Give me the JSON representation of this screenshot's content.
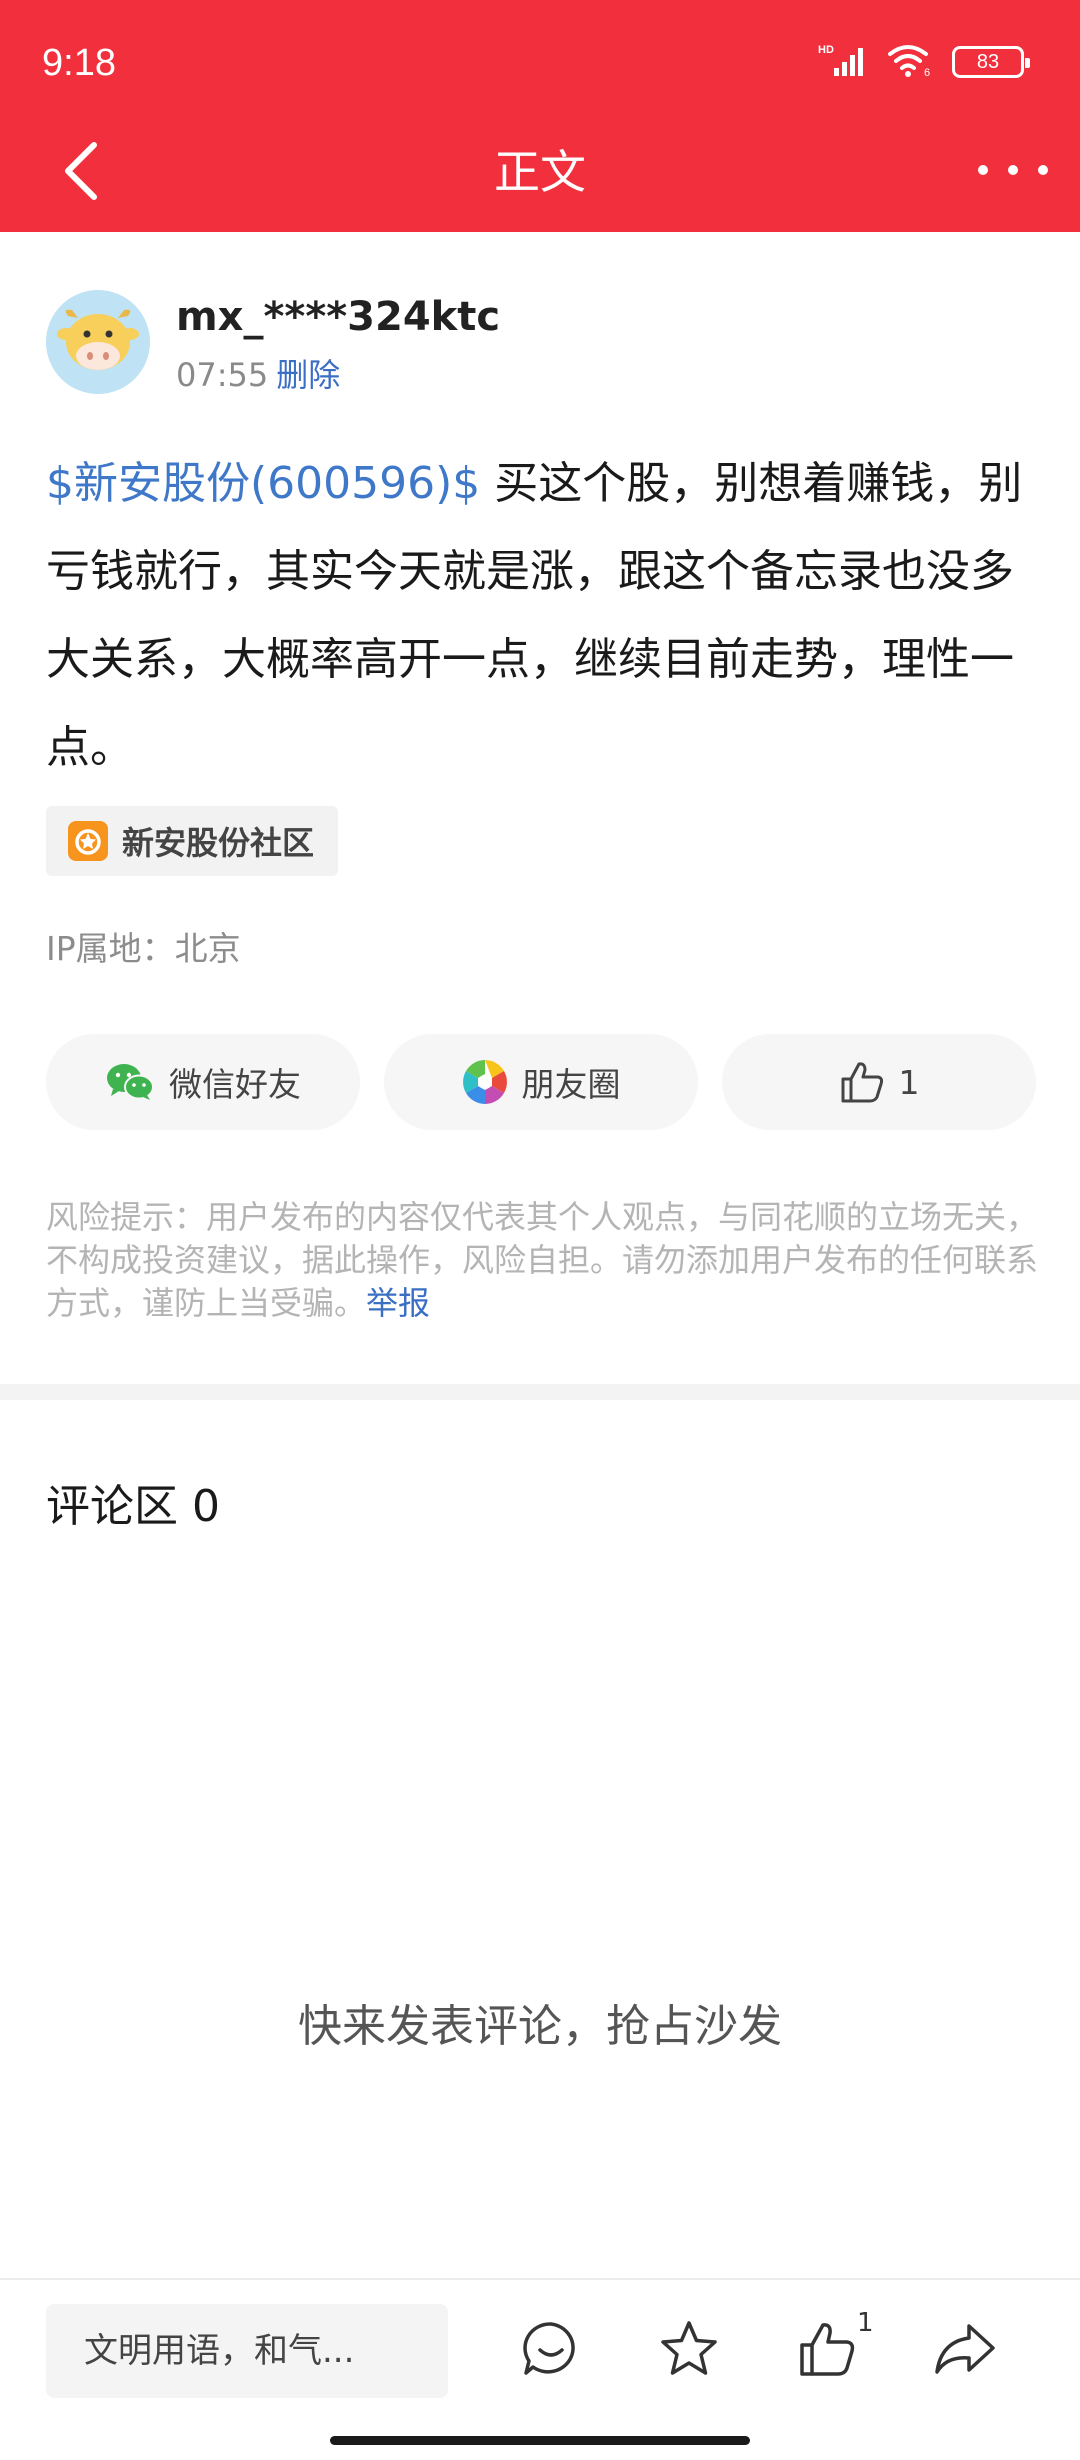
{
  "status_bar": {
    "time": "9:18",
    "battery": "83",
    "network_badge": "HD"
  },
  "header": {
    "title": "正文",
    "background_color": "#f2303d"
  },
  "post": {
    "author": {
      "username": "mx_****324ktc",
      "time": "07:55",
      "delete_label": "删除"
    },
    "stock_link": "$新安股份(600596)$",
    "body": " 买这个股，别想着赚钱，别亏钱就行，其实今天就是涨，跟这个备忘录也没多大关系，大概率高开一点，继续目前走势，理性一点。",
    "community_tag": "新安股份社区",
    "ip_location": "IP属地：北京"
  },
  "share": {
    "wechat_label": "微信好友",
    "moments_label": "朋友圈",
    "like_count": "1"
  },
  "risk": {
    "text": "风险提示：用户发布的内容仅代表其个人观点，与同花顺的立场无关，不构成投资建议，据此操作，风险自担。请勿添加用户发布的任何联系方式，谨防上当受骗。",
    "report_label": "举报"
  },
  "comments": {
    "title": "评论区 0",
    "empty_text": "快来发表评论，抢占沙发"
  },
  "bottom_bar": {
    "input_placeholder": "文明用语，和气...",
    "like_count": "1",
    "icons": [
      "comment-icon",
      "star-icon",
      "thumbs-up-icon",
      "share-icon"
    ]
  },
  "colors": {
    "accent_red": "#f2303d",
    "link_blue": "#3f78c8",
    "wechat_green": "#3fb34f"
  }
}
